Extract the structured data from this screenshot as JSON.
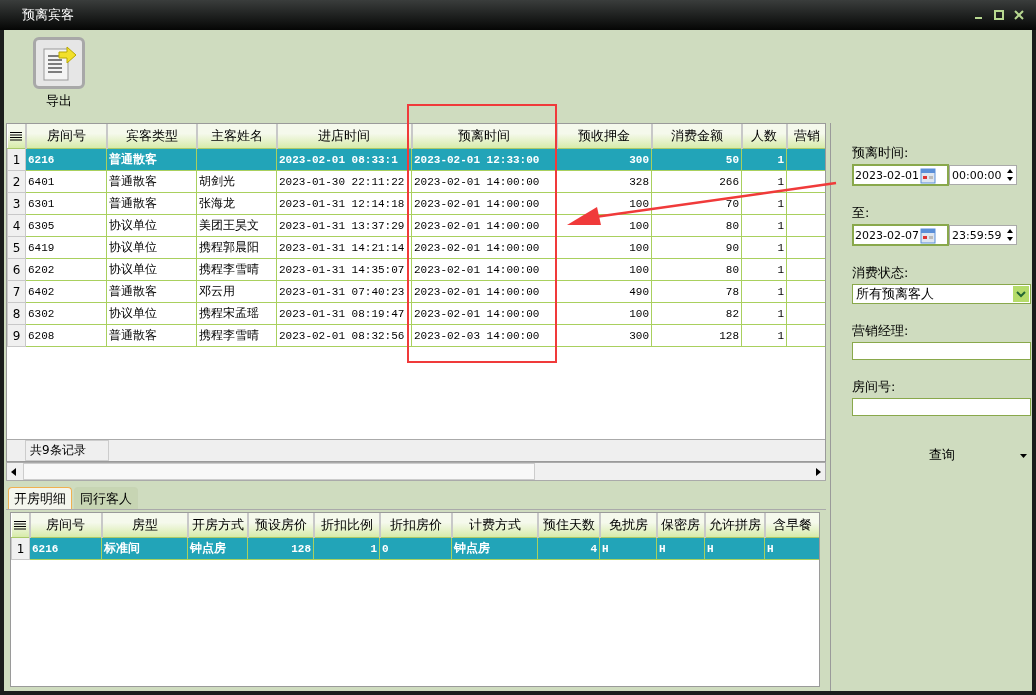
{
  "window": {
    "title": "预离宾客"
  },
  "toolbar": [
    {
      "label": "导出"
    }
  ],
  "guest_grid": {
    "columns": [
      "房间号",
      "宾客类型",
      "主客姓名",
      "进店时间",
      "预离时间",
      "预收押金",
      "消费金额",
      "人数",
      "营销"
    ],
    "rows": [
      {
        "number": "1",
        "selected": true,
        "cells": [
          "6216",
          "普通散客",
          "",
          "2023-02-01 08:33:1",
          "2023-02-01 12:33:00",
          "300",
          "50",
          "1",
          ""
        ]
      },
      {
        "number": "2",
        "selected": false,
        "cells": [
          "6401",
          "普通散客",
          "胡剑光",
          "2023-01-30 22:11:22",
          "2023-02-01 14:00:00",
          "328",
          "266",
          "1",
          ""
        ]
      },
      {
        "number": "3",
        "selected": false,
        "cells": [
          "6301",
          "普通散客",
          "张海龙",
          "2023-01-31 12:14:18",
          "2023-02-01 14:00:00",
          "100",
          "70",
          "1",
          ""
        ]
      },
      {
        "number": "4",
        "selected": false,
        "cells": [
          "6305",
          "协议单位",
          "美团王昊文",
          "2023-01-31 13:37:29",
          "2023-02-01 14:00:00",
          "100",
          "80",
          "1",
          ""
        ]
      },
      {
        "number": "5",
        "selected": false,
        "cells": [
          "6419",
          "协议单位",
          "携程郭晨阳",
          "2023-01-31 14:21:14",
          "2023-02-01 14:00:00",
          "100",
          "90",
          "1",
          ""
        ]
      },
      {
        "number": "6",
        "selected": false,
        "cells": [
          "6202",
          "协议单位",
          "携程李雪晴",
          "2023-01-31 14:35:07",
          "2023-02-01 14:00:00",
          "100",
          "80",
          "1",
          ""
        ]
      },
      {
        "number": "7",
        "selected": false,
        "cells": [
          "6402",
          "普通散客",
          "邓云用",
          "2023-01-31 07:40:23",
          "2023-02-01 14:00:00",
          "490",
          "78",
          "1",
          ""
        ]
      },
      {
        "number": "8",
        "selected": false,
        "cells": [
          "6302",
          "协议单位",
          "携程宋孟瑶",
          "2023-01-31 08:19:47",
          "2023-02-01 14:00:00",
          "100",
          "82",
          "1",
          ""
        ]
      },
      {
        "number": "9",
        "selected": false,
        "cells": [
          "6208",
          "普通散客",
          "携程李雪晴",
          "2023-02-01 08:32:56",
          "2023-02-03 14:00:00",
          "300",
          "128",
          "1",
          ""
        ]
      }
    ],
    "record_count": "共9条记录"
  },
  "tabs": [
    {
      "label": "开房明细",
      "selected": true
    },
    {
      "label": "同行客人",
      "selected": false
    }
  ],
  "detail_grid": {
    "columns": [
      "房间号",
      "房型",
      "开房方式",
      "预设房价",
      "折扣比例",
      "折扣房价",
      "计费方式",
      "预住天数",
      "免扰房",
      "保密房",
      "允许拼房",
      "含早餐"
    ],
    "rows": [
      {
        "number": "1",
        "selected": true,
        "cells": [
          "6216",
          "标准间",
          "钟点房",
          "128",
          "1",
          "0",
          "钟点房",
          "4",
          "H",
          "H",
          "H",
          "H"
        ]
      }
    ]
  },
  "filters": [
    {
      "kind": "datetime",
      "label": "预离时间:",
      "date": "2023-02-01",
      "time": "00:00:00"
    },
    {
      "kind": "datetime",
      "label": "至:",
      "date": "2023-02-07",
      "time": "23:59:59"
    },
    {
      "kind": "select",
      "label": "消费状态:",
      "value": "所有预离客人"
    },
    {
      "kind": "text",
      "label": "营销经理:"
    },
    {
      "kind": "text",
      "label": "房间号:"
    }
  ],
  "query_button": {
    "label": "查询"
  }
}
